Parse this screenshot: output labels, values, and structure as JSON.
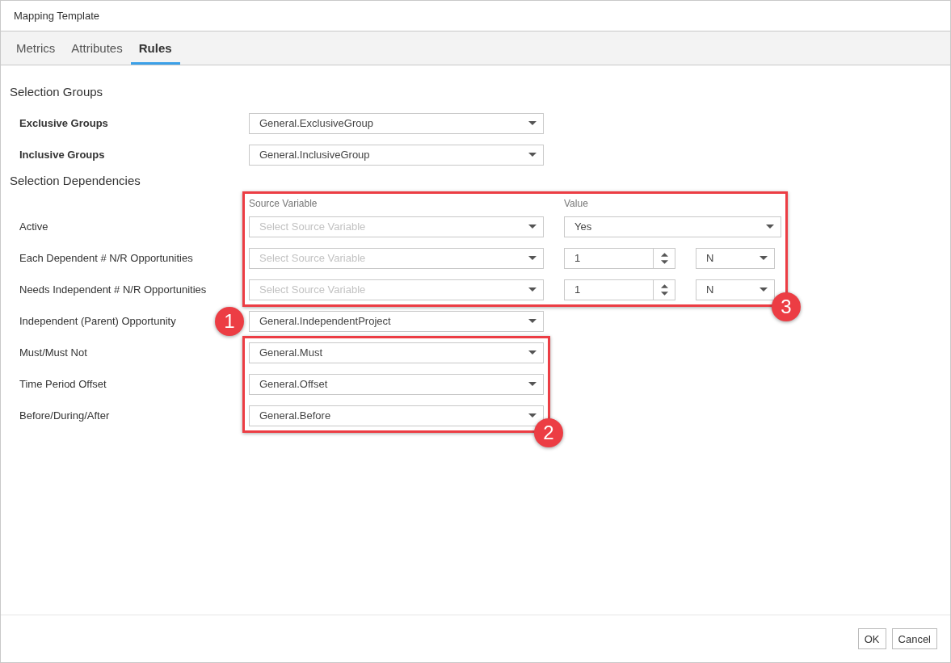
{
  "window": {
    "title": "Mapping Template"
  },
  "tabs": [
    {
      "label": "Metrics",
      "selected": false
    },
    {
      "label": "Attributes",
      "selected": false
    },
    {
      "label": "Rules",
      "selected": true
    }
  ],
  "selection_groups": {
    "title": "Selection Groups",
    "rows": [
      {
        "label": "Exclusive Groups",
        "value": "General.ExclusiveGroup"
      },
      {
        "label": "Inclusive Groups",
        "value": "General.InclusiveGroup"
      }
    ]
  },
  "selection_dependencies": {
    "title": "Selection Dependencies",
    "columns": [
      "Source Variable",
      "Value"
    ],
    "groups": [
      {
        "callout": {
          "number": "3",
          "boxed": true
        },
        "rows": [
          {
            "label": "Active",
            "source": {
              "placeholder": "Select Source Variable"
            },
            "value": {
              "kind": "dropdown",
              "value": "Yes"
            }
          },
          {
            "label": "Each Dependent # N/R Opportunities",
            "source": {
              "placeholder": "Select Source Variable"
            },
            "value": {
              "kind": "spinner",
              "value": "1",
              "unit": "N"
            }
          },
          {
            "label": "Needs Independent # N/R Opportunities",
            "source": {
              "placeholder": "Select Source Variable"
            },
            "value": {
              "kind": "spinner",
              "value": "1",
              "unit": "N"
            }
          }
        ]
      },
      {
        "callout": {
          "number": "1",
          "boxed": false
        },
        "rows": [
          {
            "label": "Independent (Parent) Opportunity",
            "source": {
              "value": "General.IndependentProject"
            }
          }
        ]
      },
      {
        "callout": {
          "number": "2",
          "boxed": true
        },
        "rows": [
          {
            "label": "Must/Must Not",
            "source": {
              "value": "General.Must"
            }
          },
          {
            "label": "Time Period Offset",
            "source": {
              "value": "General.Offset"
            }
          },
          {
            "label": "Before/During/After",
            "source": {
              "value": "General.Before"
            }
          }
        ]
      }
    ]
  },
  "buttons": [
    "OK",
    "Cancel"
  ]
}
